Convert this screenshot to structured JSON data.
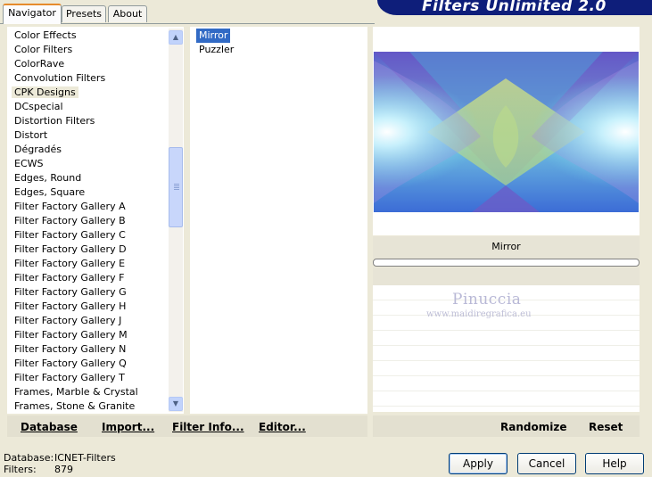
{
  "tabs": [
    {
      "label": "Navigator",
      "active": true
    },
    {
      "label": "Presets",
      "active": false
    },
    {
      "label": "About",
      "active": false
    }
  ],
  "banner": {
    "title": "Filters Unlimited 2.0"
  },
  "filter_categories": [
    "Color Effects",
    "Color Filters",
    "ColorRave",
    "Convolution Filters",
    "CPK Designs",
    "DCspecial",
    "Distortion Filters",
    "Distort",
    "Dégradés",
    "ECWS",
    "Edges, Round",
    "Edges, Square",
    "Filter Factory Gallery A",
    "Filter Factory Gallery B",
    "Filter Factory Gallery C",
    "Filter Factory Gallery D",
    "Filter Factory Gallery E",
    "Filter Factory Gallery F",
    "Filter Factory Gallery G",
    "Filter Factory Gallery H",
    "Filter Factory Gallery J",
    "Filter Factory Gallery M",
    "Filter Factory Gallery N",
    "Filter Factory Gallery Q",
    "Filter Factory Gallery T",
    "Frames, Marble & Crystal",
    "Frames, Stone & Granite"
  ],
  "selected_category": "CPK Designs",
  "filters": [
    "Mirror",
    "Puzzler"
  ],
  "selected_filter": "Mirror",
  "params": {
    "title": "Mirror",
    "row_count": 8
  },
  "watermark": {
    "name": "Pinuccia",
    "url": "www.maidiregrafica.eu"
  },
  "left_toolbar": {
    "database": "Database",
    "import": "Import...",
    "filter_info": "Filter Info...",
    "editor": "Editor..."
  },
  "right_toolbar": {
    "randomize": "Randomize",
    "reset": "Reset"
  },
  "status": {
    "database_label": "Database:",
    "database_value": "ICNET-Filters",
    "filters_label": "Filters:",
    "filters_value": "879"
  },
  "buttons": {
    "apply": "Apply",
    "cancel": "Cancel",
    "help": "Help"
  },
  "colors": {
    "selection": "#316ac5",
    "banner": "#0e1e7a",
    "dialog_bg": "#ece9d8",
    "tab_highlight": "#e68b2c"
  },
  "scrollbar": {
    "position_fraction": 0.38
  }
}
